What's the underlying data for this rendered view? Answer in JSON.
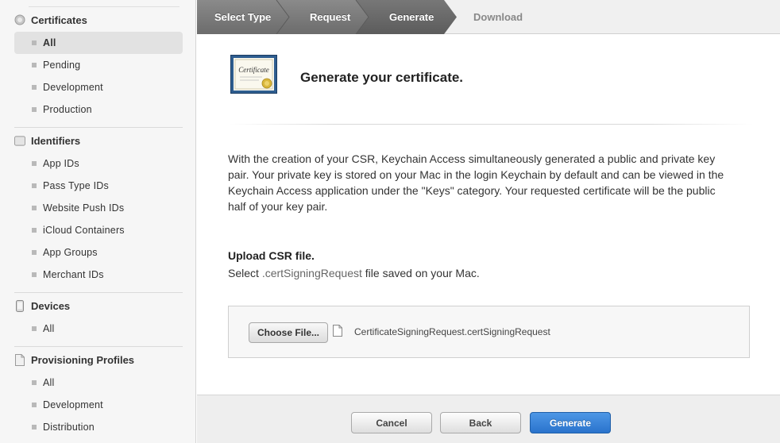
{
  "sidebar": {
    "certificates": {
      "title": "Certificates",
      "items": [
        {
          "label": "All"
        },
        {
          "label": "Pending"
        },
        {
          "label": "Development"
        },
        {
          "label": "Production"
        }
      ]
    },
    "identifiers": {
      "title": "Identifiers",
      "icon_text": "ID",
      "items": [
        {
          "label": "App IDs"
        },
        {
          "label": "Pass Type IDs"
        },
        {
          "label": "Website Push IDs"
        },
        {
          "label": "iCloud Containers"
        },
        {
          "label": "App Groups"
        },
        {
          "label": "Merchant IDs"
        }
      ]
    },
    "devices": {
      "title": "Devices",
      "items": [
        {
          "label": "All"
        }
      ]
    },
    "profiles": {
      "title": "Provisioning Profiles",
      "items": [
        {
          "label": "All"
        },
        {
          "label": "Development"
        },
        {
          "label": "Distribution"
        }
      ]
    }
  },
  "steps": [
    {
      "label": "Select Type",
      "state": "done"
    },
    {
      "label": "Request",
      "state": "done"
    },
    {
      "label": "Generate",
      "state": "current"
    },
    {
      "label": "Download",
      "state": "pending"
    }
  ],
  "main": {
    "cert_badge_text": "Certificate",
    "title": "Generate your certificate.",
    "description": "With the creation of your CSR, Keychain Access simultaneously generated a public and private key pair. Your private key is stored on your Mac in the login Keychain by default and can be viewed in the Keychain Access application under the \"Keys\" category. Your requested certificate will be the public half of your key pair.",
    "upload_title": "Upload CSR file.",
    "upload_sub_prefix": "Select ",
    "upload_sub_ext": ".certSigningRequest",
    "upload_sub_suffix": " file saved on your Mac.",
    "choose_file_label": "Choose File...",
    "file_name": "CertificateSigningRequest.certSigningRequest"
  },
  "footer": {
    "cancel_label": "Cancel",
    "back_label": "Back",
    "generate_label": "Generate"
  },
  "colors": {
    "accent_blue": "#2a73cc",
    "step_done": "#777777",
    "step_current": "#646464"
  }
}
